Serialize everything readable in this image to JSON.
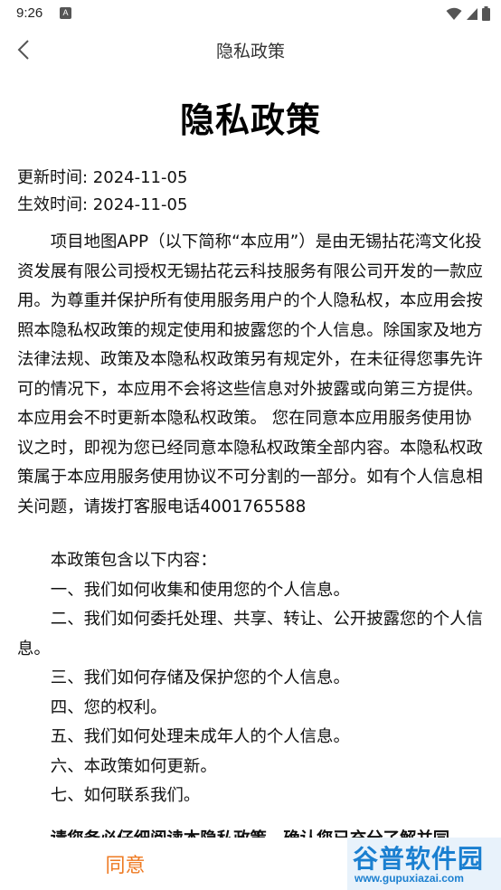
{
  "status_bar": {
    "time": "9:26",
    "notification_icon_letter": "A",
    "icons": [
      "wifi-icon",
      "signal-icon",
      "battery-icon"
    ]
  },
  "nav": {
    "title": "隐私政策",
    "back_icon": "chevron-left-icon"
  },
  "document": {
    "title": "隐私政策",
    "updated": "更新时间: 2024-11-05",
    "effective": "生效时间: 2024-11-05",
    "intro": "项目地图APP（以下简称“本应用”）是由无锡拈花湾文化投资发展有限公司授权无锡拈花云科技服务有限公司开发的一款应用。为尊重并保护所有使用服务用户的个人隐私权，本应用会按照本隐私权政策的规定使用和披露您的个人信息。除国家及地方法律法规、政策及本隐私权政策另有规定外，在未征得您事先许可的情况下，本应用不会将这些信息对外披露或向第三方提供。本应用会不时更新本隐私权政策。 您在同意本应用服务使用协议之时，即视为您已经同意本隐私权政策全部内容。本隐私权政策属于本应用服务使用协议不可分割的一部分。如有个人信息相关问题，请拨打客服电话4001765588",
    "toc_heading": "本政策包含以下内容：",
    "toc_items": [
      "一、我们如何收集和使用您的个人信息。",
      "二、我们如何委托处理、共享、转让、公开披露您的个人信息。",
      "三、我们如何存储及保护您的个人信息。",
      "四、您的权利。",
      "五、我们如何处理未成年人的个人信息。",
      "六、本政策如何更新。",
      "七、如何联系我们。"
    ],
    "cut_off_text": "请您务必仔细阅读本隐私政策，确认您已充分了解并同"
  },
  "bottom": {
    "agree_label": "同意",
    "agree_color": "#ee7a22"
  },
  "watermark": {
    "name": "谷普软件园",
    "url": "www.gupuxiazai.com"
  }
}
